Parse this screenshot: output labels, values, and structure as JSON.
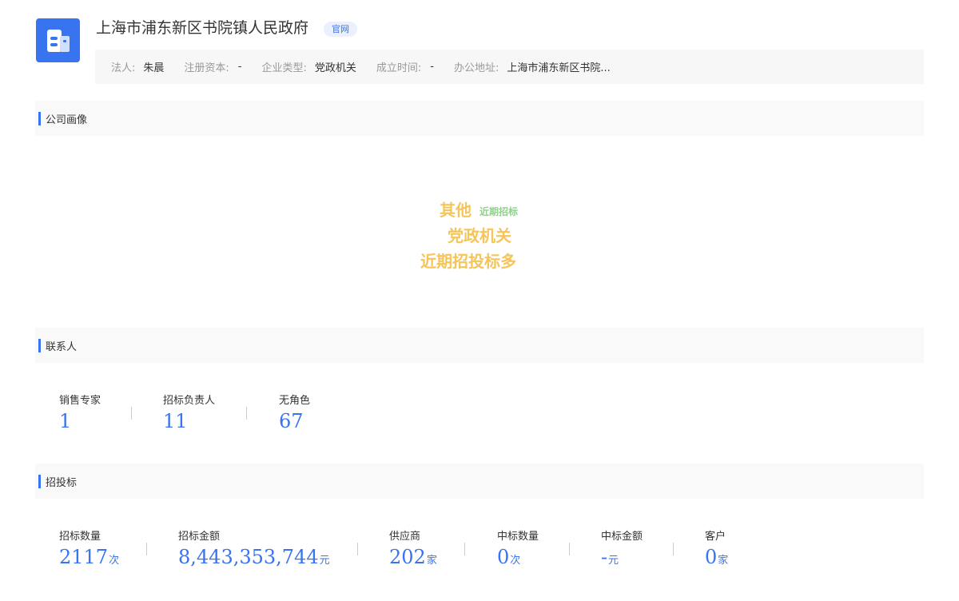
{
  "company": {
    "name": "上海市浦东新区书院镇人民政府",
    "official_badge": "官网"
  },
  "info": {
    "legal_person_label": "法人:",
    "legal_person": "朱晨",
    "capital_label": "注册资本:",
    "capital": "-",
    "type_label": "企业类型:",
    "type": "党政机关",
    "founded_label": "成立时间:",
    "founded": "-",
    "address_label": "办公地址:",
    "address": "上海市浦东新区书院..."
  },
  "sections": {
    "profile": "公司画像",
    "contacts": "联系人",
    "bidding": "招投标"
  },
  "word_cloud": [
    "其他",
    "近期招标",
    "党政机关",
    "近期招投标多"
  ],
  "contacts": [
    {
      "label": "销售专家",
      "value": "1"
    },
    {
      "label": "招标负责人",
      "value": "11"
    },
    {
      "label": "无角色",
      "value": "67"
    }
  ],
  "bidding": [
    {
      "label": "招标数量",
      "value": "2117",
      "unit": "次"
    },
    {
      "label": "招标金额",
      "value": "8,443,353,744",
      "unit": "元"
    },
    {
      "label": "供应商",
      "value": "202",
      "unit": "家"
    },
    {
      "label": "中标数量",
      "value": "0",
      "unit": "次"
    },
    {
      "label": "中标金额",
      "value": "-",
      "unit": "元"
    },
    {
      "label": "客户",
      "value": "0",
      "unit": "家"
    }
  ],
  "colors": {
    "accent": "#3873f0",
    "cloud_primary": "#f5c55a",
    "cloud_secondary": "#8fd18b"
  }
}
